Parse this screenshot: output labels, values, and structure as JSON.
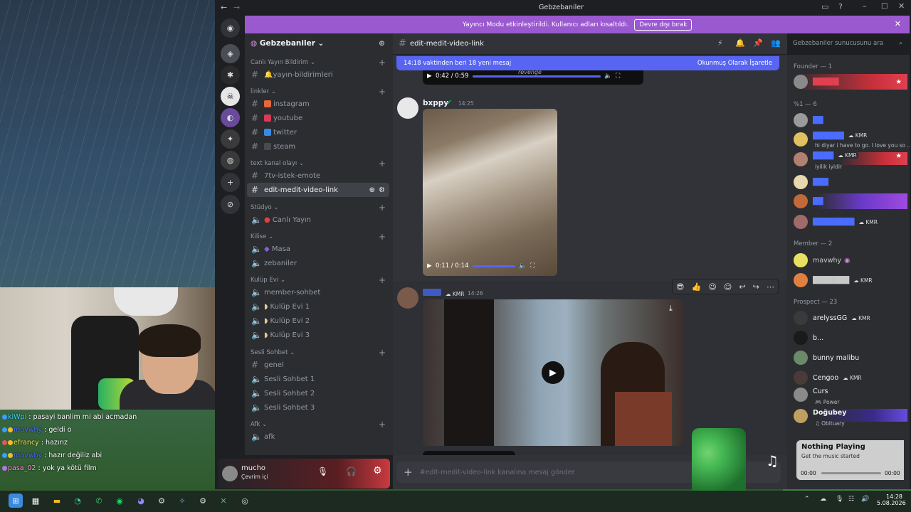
{
  "window": {
    "title": "Gebzebaniler"
  },
  "notice": {
    "text": "Yayıncı Modu etkinleştirildi. Kullanıcı adları kısaltıldı.",
    "button": "Devre dışı bırak"
  },
  "server": {
    "name": "Gebzebaniler"
  },
  "categories": [
    {
      "label": "Canlı Yayın Bildirim"
    },
    {
      "label": "linkler"
    },
    {
      "label": "text kanal olayı"
    },
    {
      "label": "Stüdyo"
    },
    {
      "label": "Kilise"
    },
    {
      "label": "Kulüp Evi"
    },
    {
      "label": "Sesli Sohbet"
    },
    {
      "label": "Afk"
    }
  ],
  "channels": {
    "yayin": "yayın-bildirimleri",
    "instagram": "instagram",
    "youtube": "youtube",
    "twitter": "twitter",
    "steam": "steam",
    "emote": "7tv-istek-emote",
    "edit": "edit-medit-video-link",
    "canli": "Canlı Yayın",
    "masa": "Masa",
    "zebaniler": "zebaniler",
    "member": "member-sohbet",
    "kulup1": "Kulüp Evi 1",
    "kulup2": "Kulüp Evi 2",
    "kulup3": "Kulüp Evi 3",
    "genel": "genel",
    "sesli1": "Sesli Sohbet 1",
    "sesli2": "Sesli Sohbet 2",
    "sesli3": "Sesli Sohbet 3",
    "afk": "afk"
  },
  "header": {
    "channel": "edit-medit-video-link",
    "search_placeholder": "Gebzebaniler sunucusunu ara"
  },
  "newmsg": {
    "text": "14:18 vaktinden beri 18 yeni mesaj",
    "action": "Okunmuş Olarak İşaretle"
  },
  "messages": {
    "top_video_time": "0:42 / 0:59",
    "top_video_caption": "revenge",
    "m1_author": "bxppy",
    "m1_time": "14:25",
    "m1_video_time": "0:11 / 0:14",
    "m2_tag": "KMR",
    "m2_time": "14:26"
  },
  "input": {
    "placeholder": "#edit-medit-video-link kanalına mesaj gönder"
  },
  "user": {
    "name": "mucho",
    "status": "Çevrim içi"
  },
  "members": {
    "founder": "Founder — 1",
    "g1": "%1 — 6",
    "g1_sub1": "hi diyar i have to go. I love you so ...",
    "g1_sub2": "iyilik iyidir",
    "member": "Member — 2",
    "m_name": "mavwhy",
    "prospect": "Prospect — 23",
    "p1": "arelyssGG",
    "p2": "b...",
    "p3": "bunny malibu",
    "p4": "Cengoo",
    "p5": "Curs",
    "p5_sub": "Power",
    "p6": "Doğubey",
    "p6_sub": "Obituary",
    "kmr": "KMR"
  },
  "music": {
    "title": "Nothing Playing",
    "sub": "Get the music started",
    "t0": "00:00",
    "t1": "00:00"
  },
  "chat": [
    {
      "user": "kiWpi",
      "color": "#38d9ff",
      "text": ": pasayi banlim mi abi acmadan"
    },
    {
      "user": "mavwhy",
      "color": "#4a6cff",
      "text": ": geldi o"
    },
    {
      "user": "efrancy",
      "color": "#f4e44a",
      "text": ": hazırız"
    },
    {
      "user": "mavwhy",
      "color": "#4a6cff",
      "text": ": hazır değiliz abi"
    },
    {
      "user": "pasa_02",
      "color": "#ff8ad8",
      "text": ": yok ya kötü film"
    }
  ],
  "clock": {
    "time": "14:28",
    "date": "5.08.2026"
  }
}
